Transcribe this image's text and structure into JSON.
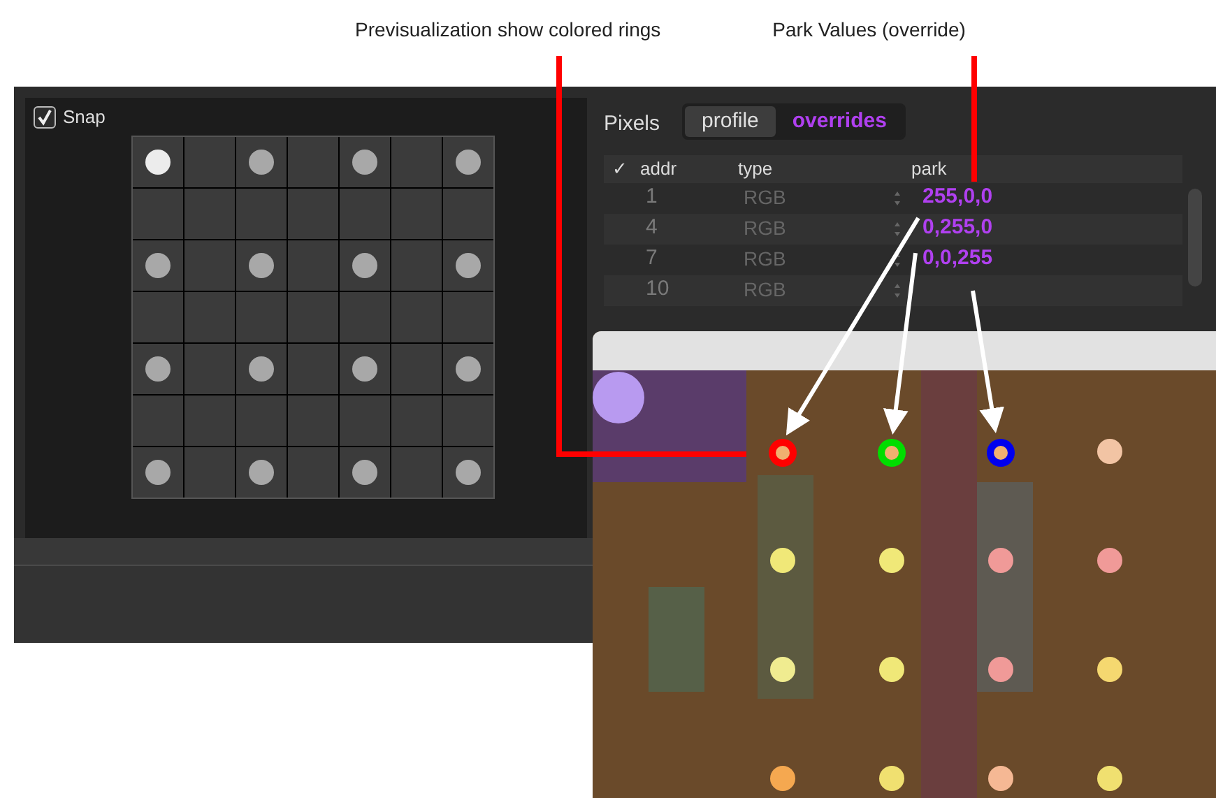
{
  "annotations": [
    {
      "text": "Previsualization show colored rings"
    },
    {
      "text": "Park Values (override)"
    }
  ],
  "snap": {
    "label": "Snap",
    "checked": true
  },
  "grid_dots": [
    {
      "selected": true
    },
    {
      "selected": false
    },
    {
      "selected": false
    },
    {
      "selected": false
    },
    {
      "selected": false
    },
    {
      "selected": false
    },
    {
      "selected": false
    },
    {
      "selected": false
    },
    {
      "selected": false
    },
    {
      "selected": false
    },
    {
      "selected": false
    },
    {
      "selected": false
    },
    {
      "selected": false
    },
    {
      "selected": false
    },
    {
      "selected": false
    },
    {
      "selected": false
    }
  ],
  "pixels_panel": {
    "title": "Pixels",
    "tabs": [
      {
        "label": "profile",
        "selected": false
      },
      {
        "label": "overrides",
        "selected": true
      }
    ],
    "columns": [
      "✓",
      "addr",
      "type",
      "park"
    ],
    "rows": [
      {
        "addr": "1",
        "type": "RGB",
        "park": "255,0,0"
      },
      {
        "addr": "4",
        "type": "RGB",
        "park": "0,255,0"
      },
      {
        "addr": "7",
        "type": "RGB",
        "park": "0,0,255"
      },
      {
        "addr": "10",
        "type": "RGB"
      }
    ]
  },
  "preview": {
    "dots": [
      {
        "color": "#f0b070",
        "ring": {
          "color": "#ff0000"
        }
      },
      {
        "color": "#f0b070",
        "ring": {
          "color": "#00dd00"
        }
      },
      {
        "color": "#f0b070",
        "ring": {
          "color": "#0000ee"
        }
      },
      {
        "color": "#f2c4a4"
      },
      {
        "color": "#f0e878"
      },
      {
        "color": "#f0e878"
      },
      {
        "color": "#f09a98"
      },
      {
        "color": "#f09a98"
      },
      {
        "color": "#f0ec90"
      },
      {
        "color": "#f0e878"
      },
      {
        "color": "#f09a98"
      },
      {
        "color": "#f5d870"
      },
      {
        "color": "#f5a850"
      },
      {
        "color": "#f0e070"
      },
      {
        "color": "#f5b894"
      },
      {
        "color": "#f0e070"
      }
    ]
  }
}
